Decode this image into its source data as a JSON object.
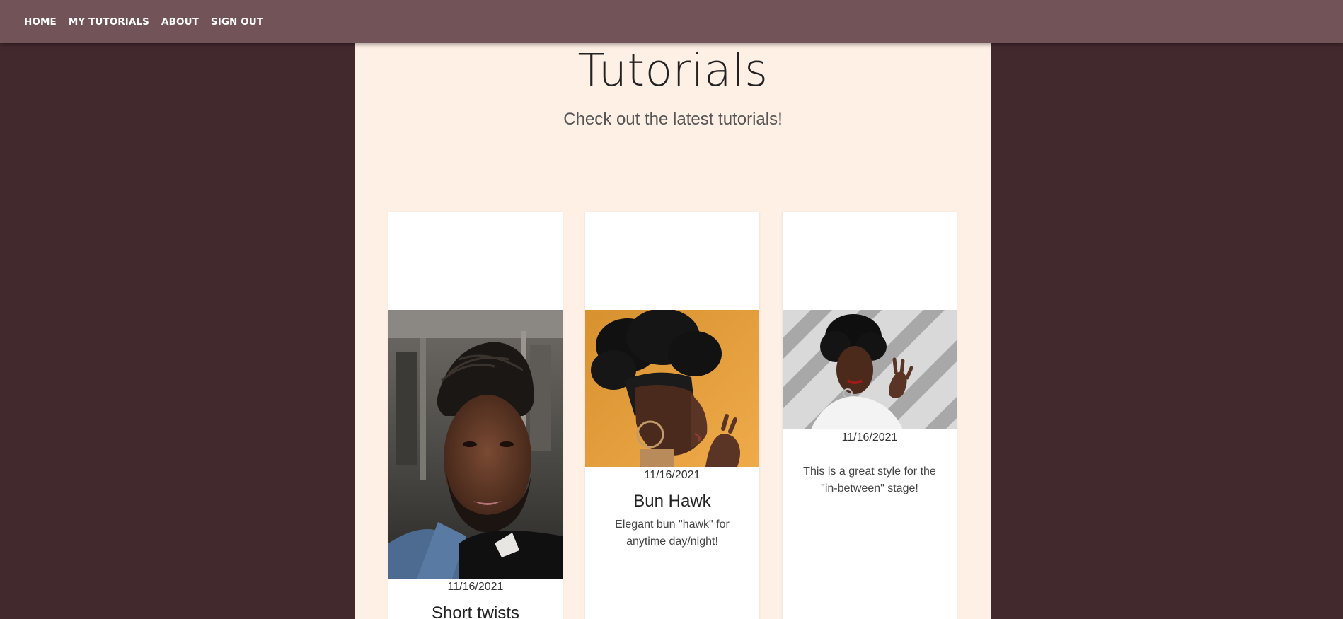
{
  "nav": {
    "home": "HOME",
    "my_tutorials": "MY TUTORIALS",
    "about": "ABOUT",
    "sign_out": "SIGN OUT"
  },
  "page": {
    "title": "Tutorials",
    "subtitle": "Check out the latest tutorials!"
  },
  "cards": [
    {
      "date": "11/16/2021",
      "title": "Short twists",
      "description": "",
      "image": "man-with-short-twists-photo"
    },
    {
      "date": "11/16/2021",
      "title": "Bun Hawk",
      "description": "Elegant bun \"hawk\" for anytime day/night!",
      "image": "woman-with-bun-hawk-photo"
    },
    {
      "date": "11/16/2021",
      "title": "",
      "description": "This is a great style for the \"in-between\" stage!",
      "image": "woman-with-short-curly-afro-photo"
    }
  ],
  "colors": {
    "page_background": "#42292d",
    "navbar": "#715358",
    "content_background": "#fff0e6",
    "card_background": "#ffffff"
  }
}
